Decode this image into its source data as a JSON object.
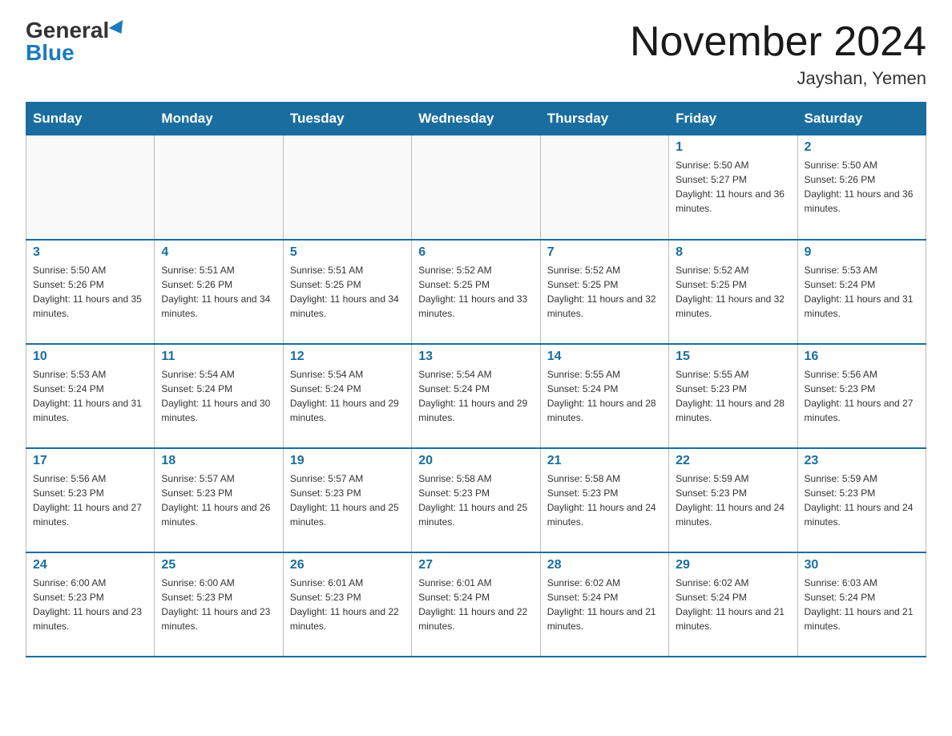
{
  "header": {
    "logo_general": "General",
    "logo_blue": "Blue",
    "month_title": "November 2024",
    "location": "Jayshan, Yemen"
  },
  "weekdays": [
    "Sunday",
    "Monday",
    "Tuesday",
    "Wednesday",
    "Thursday",
    "Friday",
    "Saturday"
  ],
  "weeks": [
    [
      {
        "day": "",
        "info": ""
      },
      {
        "day": "",
        "info": ""
      },
      {
        "day": "",
        "info": ""
      },
      {
        "day": "",
        "info": ""
      },
      {
        "day": "",
        "info": ""
      },
      {
        "day": "1",
        "info": "Sunrise: 5:50 AM\nSunset: 5:27 PM\nDaylight: 11 hours and 36 minutes."
      },
      {
        "day": "2",
        "info": "Sunrise: 5:50 AM\nSunset: 5:26 PM\nDaylight: 11 hours and 36 minutes."
      }
    ],
    [
      {
        "day": "3",
        "info": "Sunrise: 5:50 AM\nSunset: 5:26 PM\nDaylight: 11 hours and 35 minutes."
      },
      {
        "day": "4",
        "info": "Sunrise: 5:51 AM\nSunset: 5:26 PM\nDaylight: 11 hours and 34 minutes."
      },
      {
        "day": "5",
        "info": "Sunrise: 5:51 AM\nSunset: 5:25 PM\nDaylight: 11 hours and 34 minutes."
      },
      {
        "day": "6",
        "info": "Sunrise: 5:52 AM\nSunset: 5:25 PM\nDaylight: 11 hours and 33 minutes."
      },
      {
        "day": "7",
        "info": "Sunrise: 5:52 AM\nSunset: 5:25 PM\nDaylight: 11 hours and 32 minutes."
      },
      {
        "day": "8",
        "info": "Sunrise: 5:52 AM\nSunset: 5:25 PM\nDaylight: 11 hours and 32 minutes."
      },
      {
        "day": "9",
        "info": "Sunrise: 5:53 AM\nSunset: 5:24 PM\nDaylight: 11 hours and 31 minutes."
      }
    ],
    [
      {
        "day": "10",
        "info": "Sunrise: 5:53 AM\nSunset: 5:24 PM\nDaylight: 11 hours and 31 minutes."
      },
      {
        "day": "11",
        "info": "Sunrise: 5:54 AM\nSunset: 5:24 PM\nDaylight: 11 hours and 30 minutes."
      },
      {
        "day": "12",
        "info": "Sunrise: 5:54 AM\nSunset: 5:24 PM\nDaylight: 11 hours and 29 minutes."
      },
      {
        "day": "13",
        "info": "Sunrise: 5:54 AM\nSunset: 5:24 PM\nDaylight: 11 hours and 29 minutes."
      },
      {
        "day": "14",
        "info": "Sunrise: 5:55 AM\nSunset: 5:24 PM\nDaylight: 11 hours and 28 minutes."
      },
      {
        "day": "15",
        "info": "Sunrise: 5:55 AM\nSunset: 5:23 PM\nDaylight: 11 hours and 28 minutes."
      },
      {
        "day": "16",
        "info": "Sunrise: 5:56 AM\nSunset: 5:23 PM\nDaylight: 11 hours and 27 minutes."
      }
    ],
    [
      {
        "day": "17",
        "info": "Sunrise: 5:56 AM\nSunset: 5:23 PM\nDaylight: 11 hours and 27 minutes."
      },
      {
        "day": "18",
        "info": "Sunrise: 5:57 AM\nSunset: 5:23 PM\nDaylight: 11 hours and 26 minutes."
      },
      {
        "day": "19",
        "info": "Sunrise: 5:57 AM\nSunset: 5:23 PM\nDaylight: 11 hours and 25 minutes."
      },
      {
        "day": "20",
        "info": "Sunrise: 5:58 AM\nSunset: 5:23 PM\nDaylight: 11 hours and 25 minutes."
      },
      {
        "day": "21",
        "info": "Sunrise: 5:58 AM\nSunset: 5:23 PM\nDaylight: 11 hours and 24 minutes."
      },
      {
        "day": "22",
        "info": "Sunrise: 5:59 AM\nSunset: 5:23 PM\nDaylight: 11 hours and 24 minutes."
      },
      {
        "day": "23",
        "info": "Sunrise: 5:59 AM\nSunset: 5:23 PM\nDaylight: 11 hours and 24 minutes."
      }
    ],
    [
      {
        "day": "24",
        "info": "Sunrise: 6:00 AM\nSunset: 5:23 PM\nDaylight: 11 hours and 23 minutes."
      },
      {
        "day": "25",
        "info": "Sunrise: 6:00 AM\nSunset: 5:23 PM\nDaylight: 11 hours and 23 minutes."
      },
      {
        "day": "26",
        "info": "Sunrise: 6:01 AM\nSunset: 5:23 PM\nDaylight: 11 hours and 22 minutes."
      },
      {
        "day": "27",
        "info": "Sunrise: 6:01 AM\nSunset: 5:24 PM\nDaylight: 11 hours and 22 minutes."
      },
      {
        "day": "28",
        "info": "Sunrise: 6:02 AM\nSunset: 5:24 PM\nDaylight: 11 hours and 21 minutes."
      },
      {
        "day": "29",
        "info": "Sunrise: 6:02 AM\nSunset: 5:24 PM\nDaylight: 11 hours and 21 minutes."
      },
      {
        "day": "30",
        "info": "Sunrise: 6:03 AM\nSunset: 5:24 PM\nDaylight: 11 hours and 21 minutes."
      }
    ]
  ]
}
